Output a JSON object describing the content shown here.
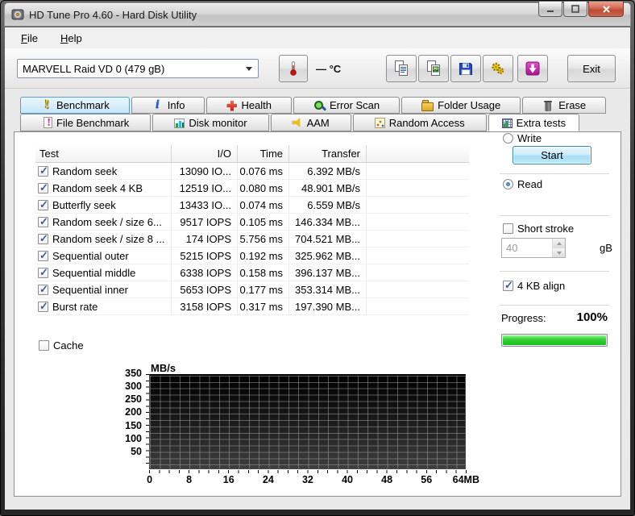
{
  "window": {
    "title": "HD Tune Pro 4.60 - Hard Disk Utility",
    "icons": [
      "app-disk-icon",
      "minimize-icon",
      "maximize-icon",
      "close-icon"
    ]
  },
  "menu": {
    "items": [
      {
        "label": "File",
        "name": "menu-item-file"
      },
      {
        "label": "Help",
        "name": "menu-item-help"
      }
    ]
  },
  "toolbar": {
    "drive_selector_value": "MARVELL Raid VD 0 (479 gB)",
    "temperature": "— °C",
    "exit_label": "Exit",
    "icons": [
      "thermometer-icon",
      "copy-text-icon",
      "copy-image-icon",
      "save-icon",
      "gears-icon",
      "download-icon"
    ]
  },
  "tabs": {
    "active": "Extra tests",
    "row1": [
      {
        "label": "Benchmark",
        "icon": "benchmark",
        "name": "tab-benchmark",
        "highlight": true
      },
      {
        "label": "Info",
        "icon": "info",
        "name": "tab-info"
      },
      {
        "label": "Health",
        "icon": "health",
        "name": "tab-health"
      },
      {
        "label": "Error Scan",
        "icon": "error-scan",
        "name": "tab-error-scan"
      },
      {
        "label": "Folder Usage",
        "icon": "folder-usage",
        "name": "tab-folder-usage"
      },
      {
        "label": "Erase",
        "icon": "erase",
        "name": "tab-erase"
      }
    ],
    "row2": [
      {
        "label": "File Benchmark",
        "icon": "file-benchmark",
        "name": "tab-file-benchmark"
      },
      {
        "label": "Disk monitor",
        "icon": "disk-monitor",
        "name": "tab-disk-monitor"
      },
      {
        "label": "AAM",
        "icon": "aam",
        "name": "tab-aam"
      },
      {
        "label": "Random Access",
        "icon": "random-access",
        "name": "tab-random-access"
      },
      {
        "label": "Extra tests",
        "icon": "extra-tests",
        "name": "tab-extra-tests",
        "active": true
      }
    ]
  },
  "table": {
    "columns": [
      "Test",
      "I/O",
      "Time",
      "Transfer"
    ],
    "rows": [
      {
        "test": "Random seek",
        "io": "13090 IO...",
        "time": "0.076 ms",
        "transfer": "6.392 MB/s",
        "checked": true
      },
      {
        "test": "Random seek 4 KB",
        "io": "12519 IO...",
        "time": "0.080 ms",
        "transfer": "48.901 MB/s",
        "checked": true
      },
      {
        "test": "Butterfly seek",
        "io": "13433 IO...",
        "time": "0.074 ms",
        "transfer": "6.559 MB/s",
        "checked": true
      },
      {
        "test": "Random seek / size 6...",
        "io": "9517 IOPS",
        "time": "0.105 ms",
        "transfer": "146.334 MB...",
        "checked": true
      },
      {
        "test": "Random seek / size 8 ...",
        "io": "174 IOPS",
        "time": "5.756 ms",
        "transfer": "704.521 MB...",
        "checked": true
      },
      {
        "test": "Sequential outer",
        "io": "5215 IOPS",
        "time": "0.192 ms",
        "transfer": "325.962 MB...",
        "checked": true
      },
      {
        "test": "Sequential middle",
        "io": "6338 IOPS",
        "time": "0.158 ms",
        "transfer": "396.137 MB...",
        "checked": true
      },
      {
        "test": "Sequential inner",
        "io": "5653 IOPS",
        "time": "0.177 ms",
        "transfer": "353.314 MB...",
        "checked": true
      },
      {
        "test": "Burst rate",
        "io": "3158 IOPS",
        "time": "0.317 ms",
        "transfer": "197.390 MB...",
        "checked": true
      }
    ]
  },
  "controls": {
    "start_label": "Start",
    "mode_options": [
      {
        "label": "Read",
        "selected": true,
        "name": "radio-read"
      },
      {
        "label": "Write",
        "selected": false,
        "name": "radio-write"
      }
    ],
    "short_stroke_label": "Short stroke",
    "short_stroke_checked": false,
    "stroke_size_value": "40",
    "stroke_size_unit": "gB",
    "align_label": "4 KB align",
    "align_checked": true,
    "progress_label": "Progress:",
    "progress_value": "100%",
    "progress_percent": 100,
    "progress_fill_color": "#2ecc2e"
  },
  "cache": {
    "label": "Cache",
    "checked": false
  },
  "chart_data": {
    "type": "line",
    "title": "",
    "xlabel": "MB",
    "ylabel": "MB/s",
    "xlim": [
      0,
      64
    ],
    "ylim": [
      0,
      362
    ],
    "xticks": [
      0,
      8,
      16,
      24,
      32,
      40,
      48,
      56,
      64
    ],
    "xtick_labels": [
      "0",
      "8",
      "16",
      "24",
      "32",
      "40",
      "48",
      "56",
      "64MB"
    ],
    "ytick_labels": [
      "350",
      "300",
      "250",
      "200",
      "150",
      "100",
      "50"
    ],
    "grid": true,
    "grid_minor_x_step": 2,
    "grid_minor_y_step": 25,
    "plot_background": "gradient #000000 to #3e3e3e",
    "legend": null,
    "series": []
  }
}
